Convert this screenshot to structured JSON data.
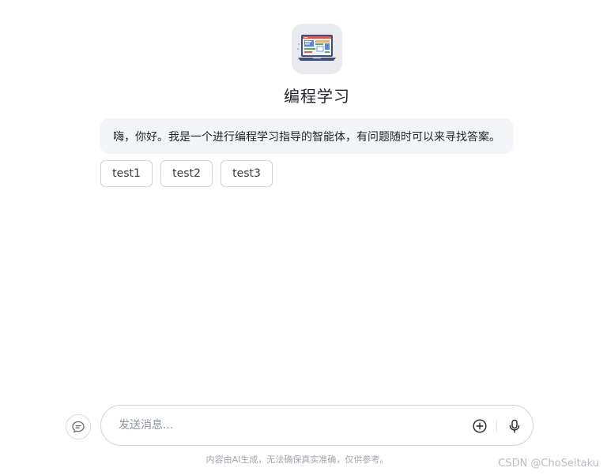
{
  "bot": {
    "name": "编程学习",
    "avatar_icon": "laptop-code-illustration"
  },
  "greeting": {
    "text": "嗨，你好。我是一个进行编程学习指导的智能体，有问题随时可以来寻找答案。"
  },
  "suggestions": [
    {
      "label": "test1"
    },
    {
      "label": "test2"
    },
    {
      "label": "test3"
    }
  ],
  "input": {
    "placeholder": "发送消息...",
    "value": ""
  },
  "disclaimer": "内容由AI生成，无法确保真实准确，仅供参考。",
  "watermark": "CSDN @ChoSeitaku",
  "colors": {
    "background": "#ffffff",
    "bubble": "#f3f4f7",
    "border": "#d0d3d9",
    "muted_text": "#8f959e"
  }
}
